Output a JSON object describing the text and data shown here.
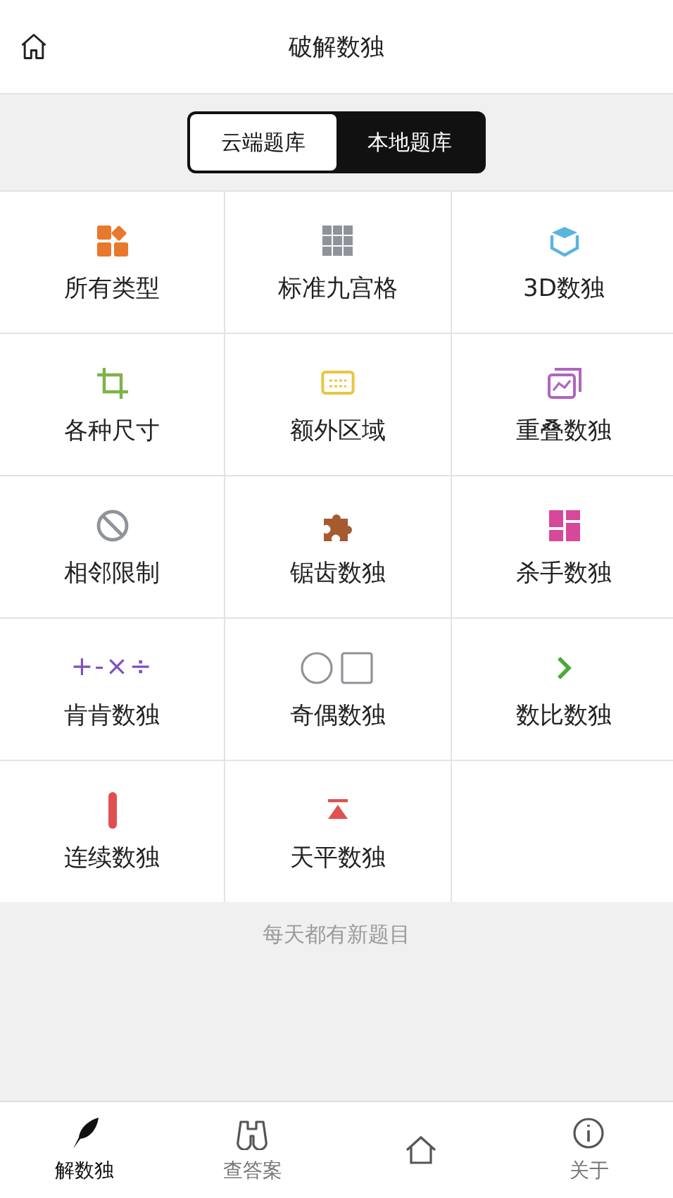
{
  "header": {
    "title": "破解数独"
  },
  "segments": [
    {
      "label": "云端题库",
      "selected": true
    },
    {
      "label": "本地题库",
      "selected": false
    }
  ],
  "types": [
    {
      "label": "所有类型",
      "color": "#e8782c"
    },
    {
      "label": "标准九宫格",
      "color": "#8e9499"
    },
    {
      "label": "3D数独",
      "color": "#5ab4e0"
    },
    {
      "label": "各种尺寸",
      "color": "#7fb24a"
    },
    {
      "label": "额外区域",
      "color": "#e8c640"
    },
    {
      "label": "重叠数独",
      "color": "#b064c0"
    },
    {
      "label": "相邻限制",
      "color": "#8e9499"
    },
    {
      "label": "锯齿数独",
      "color": "#a65a30"
    },
    {
      "label": "杀手数独",
      "color": "#d8489a"
    },
    {
      "label": "肯肯数独",
      "color": "#7e50c0",
      "symbol": "+-×÷"
    },
    {
      "label": "奇偶数独",
      "color": "#8e9499"
    },
    {
      "label": "数比数独",
      "color": "#4caa3c"
    },
    {
      "label": "连续数独",
      "color": "#e05050"
    },
    {
      "label": "天平数独",
      "color": "#e05050"
    }
  ],
  "footer_note": "每天都有新题目",
  "tabbar": [
    {
      "label": "解数独",
      "selected": true
    },
    {
      "label": "查答案",
      "selected": false
    },
    {
      "selected": false
    },
    {
      "label": "关于",
      "selected": false
    }
  ]
}
